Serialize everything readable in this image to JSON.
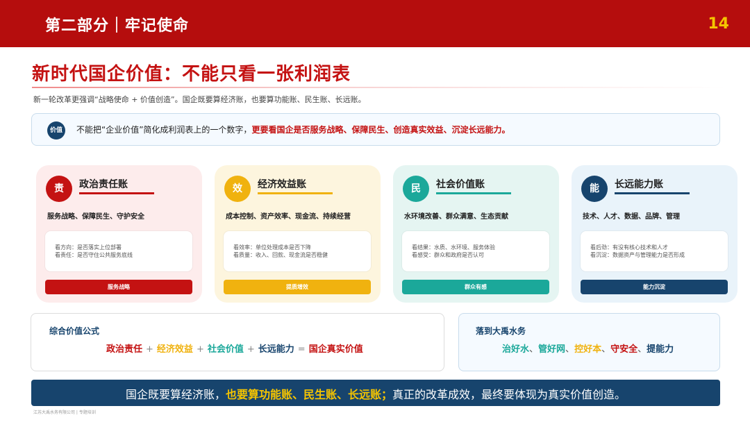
{
  "header": {
    "section": "第二部分｜牢记使命",
    "page_number": "14"
  },
  "title": "新时代国企价值：不能只看一张利润表",
  "subtitle": "新一轮改革更强调“战略使命 + 价值创造”。国企既要算经济账，也要算功能账、民生账、长远账。",
  "note": {
    "badge": "价值",
    "text_plain": "不能把“企业价值”简化成利润表上的一个数字，",
    "text_emphasis": "更要看国企是否服务战略、保障民生、创造真实效益、沉淀长远能力。"
  },
  "cards": [
    {
      "badge": "责",
      "title": "政治责任账",
      "desc": "服务战略、保障民生、守护安全",
      "line1": "看方向：是否落实上位部署",
      "line2": "看责任：是否守住公共服务底线",
      "button": "服务战略",
      "color": "#c41212",
      "bg": "#fdecec"
    },
    {
      "badge": "效",
      "title": "经济效益账",
      "desc": "成本控制、资产效率、现金流、持续经营",
      "line1": "看效率：单位处理成本是否下降",
      "line2": "看质量：收入、回款、现金流是否稳健",
      "button": "提质增效",
      "color": "#f0b20f",
      "bg": "#fdf5de"
    },
    {
      "badge": "民",
      "title": "社会价值账",
      "desc": "水环境改善、群众满意、生态贡献",
      "line1": "看结果：水质、水环境、服务体验",
      "line2": "看感受：群众和政府是否认可",
      "button": "群众有感",
      "color": "#1ba89a",
      "bg": "#e5f5f2"
    },
    {
      "badge": "能",
      "title": "长远能力账",
      "desc": "技术、人才、数据、品牌、管理",
      "line1": "看后劲：有没有核心技术和人才",
      "line2": "看沉淀：数据资产与管理能力是否形成",
      "button": "能力沉淀",
      "color": "#17446d",
      "bg": "#e9f3fa"
    }
  ],
  "formula": {
    "title": "综合价值公式",
    "terms": [
      "政治责任",
      "经济效益",
      "社会价值",
      "长远能力"
    ],
    "plus": "+",
    "equals": "=",
    "result": "国企真实价值"
  },
  "landing": {
    "title": "落到大禹水务",
    "items": [
      "治好水",
      "管好网",
      "控好本",
      "守安全",
      "提能力"
    ],
    "separator": "、"
  },
  "banner": {
    "part1": "国企既要算经济账，",
    "part2": "也要算功能账、民生账、长远账；",
    "part3": "真正的改革成效，最终要体现为真实价值创造。"
  },
  "footer": "江苏大禹水务有限公司 | 专题培训",
  "colors": {
    "brand_red": "#b50d0d",
    "accent_yellow": "#f5c400",
    "navy": "#17446d",
    "teal": "#1ba89a",
    "orange": "#f0b20f"
  }
}
